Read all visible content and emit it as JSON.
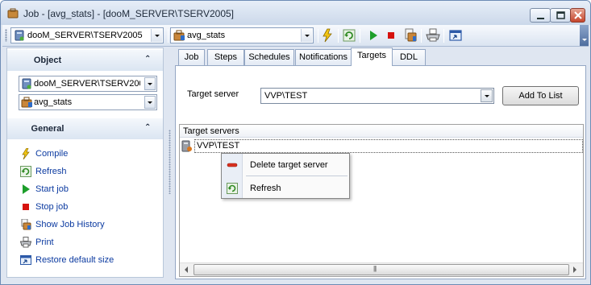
{
  "window": {
    "title": "Job - [avg_stats] - [dooM_SERVER\\TSERV2005]"
  },
  "toolbar": {
    "server_combo": "dooM_SERVER\\TSERV2005",
    "job_combo": "avg_stats",
    "tools": [
      "compile-icon",
      "refresh-icon",
      "start-job-icon",
      "stop-job-icon",
      "job-history-icon",
      "print-icon",
      "restore-size-icon"
    ]
  },
  "sidebar": {
    "object_header": "Object",
    "server_value": "dooM_SERVER\\TSERV2005",
    "job_value": "avg_stats",
    "general_header": "General",
    "actions": [
      {
        "label": "Compile",
        "icon": "lightning-icon"
      },
      {
        "label": "Refresh",
        "icon": "refresh-icon"
      },
      {
        "label": "Start job",
        "icon": "play-icon"
      },
      {
        "label": "Stop job",
        "icon": "stop-icon"
      },
      {
        "label": "Show Job History",
        "icon": "history-icon"
      },
      {
        "label": "Print",
        "icon": "printer-icon"
      },
      {
        "label": "Restore default size",
        "icon": "restore-size-icon"
      }
    ]
  },
  "tabs": [
    {
      "label": "Job",
      "active": false
    },
    {
      "label": "Steps",
      "active": false
    },
    {
      "label": "Schedules",
      "active": false
    },
    {
      "label": "Notifications",
      "active": false
    },
    {
      "label": "Targets",
      "active": true
    },
    {
      "label": "DDL",
      "active": false
    }
  ],
  "targets": {
    "target_server_label": "Target server",
    "target_server_value": "VVP\\TEST",
    "add_button": "Add To List",
    "list_header": "Target servers",
    "servers": [
      "VVP\\TEST"
    ]
  },
  "context_menu": {
    "items": [
      {
        "label": "Delete target server",
        "icon": "delete-icon"
      },
      {
        "label": "Refresh",
        "icon": "refresh-icon"
      }
    ]
  },
  "colors": {
    "link": "#0b3aa0",
    "title_text": "#1e2a3a",
    "window_border": "#6d8bb5"
  }
}
